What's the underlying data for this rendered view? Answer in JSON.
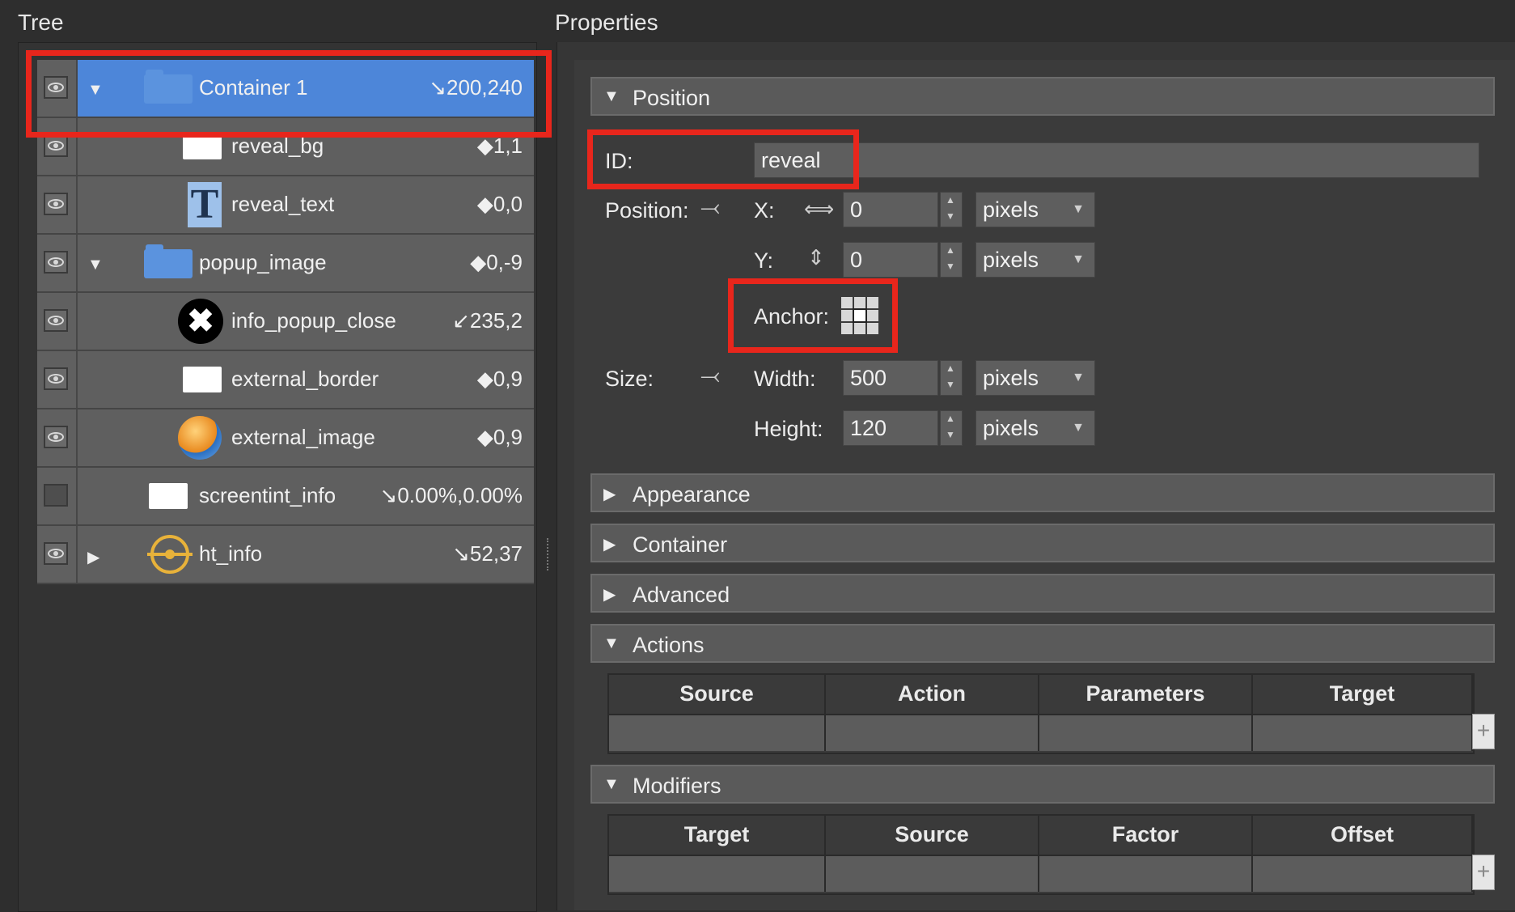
{
  "headings": {
    "tree": "Tree",
    "properties": "Properties"
  },
  "tree": {
    "items": [
      {
        "label": "Container 1",
        "coord": "↘200,240",
        "visible": true,
        "expanded": true,
        "icon": "folder-icon",
        "selected": true
      },
      {
        "label": "reveal_bg",
        "coord": "◆1,1",
        "visible": true,
        "icon": "rectangle-icon"
      },
      {
        "label": "reveal_text",
        "coord": "◆0,0",
        "visible": true,
        "icon": "text-icon",
        "glyph": "T"
      },
      {
        "label": "popup_image",
        "coord": "◆0,-9",
        "visible": true,
        "expanded": true,
        "icon": "folder-icon"
      },
      {
        "label": "info_popup_close",
        "coord": "↙235,2",
        "visible": true,
        "icon": "close-circle-icon",
        "glyph": "✖"
      },
      {
        "label": "external_border",
        "coord": "◆0,9",
        "visible": true,
        "icon": "rectangle-icon"
      },
      {
        "label": "external_image",
        "coord": "◆0,9",
        "visible": true,
        "icon": "globe-image-icon"
      },
      {
        "label": "screentint_info",
        "coord": "↘0.00%,0.00%",
        "visible": false,
        "icon": "rectangle-icon"
      },
      {
        "label": "ht_info",
        "coord": "↘52,37",
        "visible": true,
        "expanded": false,
        "icon": "hotspot-target-icon"
      }
    ]
  },
  "properties": {
    "sections": {
      "position": "Position",
      "appearance": "Appearance",
      "container": "Container",
      "advanced": "Advanced",
      "actions": "Actions",
      "modifiers": "Modifiers"
    },
    "id_label": "ID:",
    "id_value": "reveal",
    "position_label": "Position:",
    "x_label": "X:",
    "x_value": "0",
    "y_label": "Y:",
    "y_value": "0",
    "unit_pixels": "pixels",
    "anchor_label": "Anchor:",
    "size_label": "Size:",
    "width_label": "Width:",
    "width_value": "500",
    "height_label": "Height:",
    "height_value": "120",
    "actions_columns": [
      "Source",
      "Action",
      "Parameters",
      "Target"
    ],
    "modifiers_columns": [
      "Target",
      "Source",
      "Factor",
      "Offset"
    ],
    "add_symbol": "+"
  },
  "glyphs": {
    "expanded": "▼",
    "collapsed": "▶",
    "link": "⤙",
    "x_axis": "⟺",
    "y_axis": "⇕"
  },
  "colors": {
    "selection": "#4d86d9",
    "highlight": "#e8261c",
    "folder": "#5b93de"
  }
}
